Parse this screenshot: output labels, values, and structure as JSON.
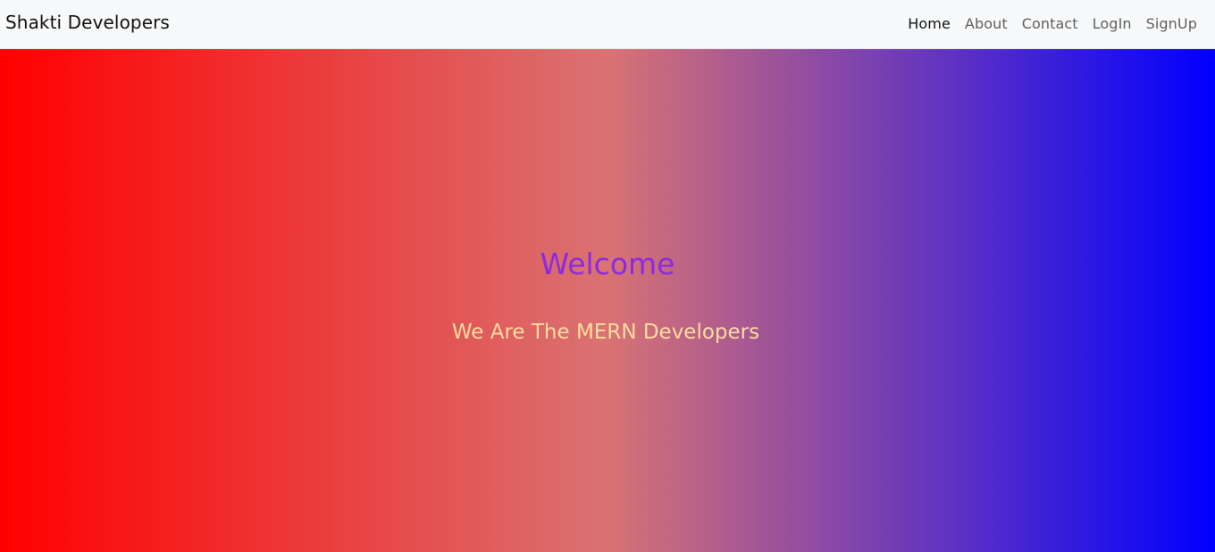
{
  "navbar": {
    "brand": "Shakti Developers",
    "links": [
      {
        "label": "Home",
        "active": true
      },
      {
        "label": "About",
        "active": false
      },
      {
        "label": "Contact",
        "active": false
      },
      {
        "label": "LogIn",
        "active": false
      },
      {
        "label": "SignUp",
        "active": false
      }
    ]
  },
  "hero": {
    "heading": "Welcome",
    "subheading": "We Are The MERN Developers",
    "gradient_colors": [
      "#ff0000",
      "#d97373",
      "#0000ff"
    ],
    "heading_color": "#8a2be2",
    "subheading_color": "#ffdca0"
  }
}
